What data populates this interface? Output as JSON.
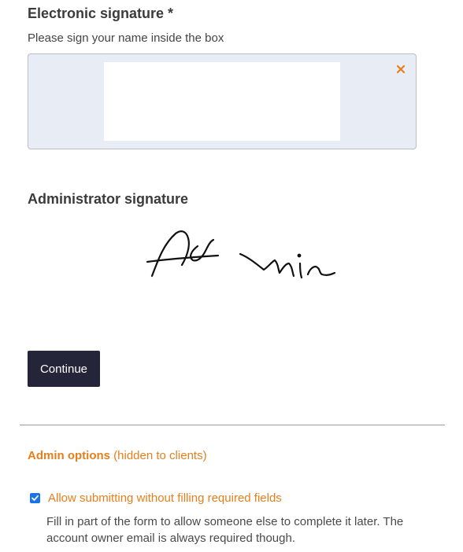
{
  "signature": {
    "title": "Electronic signature *",
    "instructions": "Please sign your name inside the box",
    "clear_icon": "close-icon"
  },
  "admin_signature": {
    "title": "Administrator signature",
    "signature_text": "Admin"
  },
  "actions": {
    "continue_label": "Continue"
  },
  "admin_options": {
    "title": "Admin options",
    "note": "(hidden to clients)",
    "checkbox": {
      "checked": true,
      "label": "Allow submitting without filling required fields"
    },
    "help_text": "Fill in part of the form to allow someone else to complete it later. The account owner email is always required though."
  },
  "colors": {
    "accent": "#e57f1e",
    "button_bg": "#25253a",
    "checkbox": "#1a73e8",
    "sig_box_bg": "#e8ecf4"
  }
}
